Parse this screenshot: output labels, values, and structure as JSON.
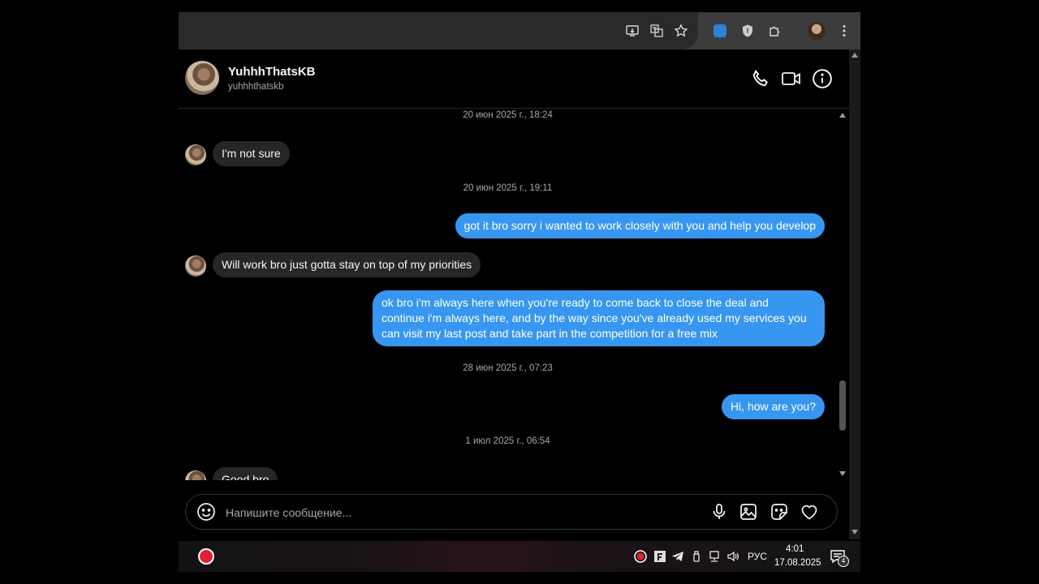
{
  "browser": {
    "icons": [
      "install-app-icon",
      "translate-icon",
      "bookmark-star-icon",
      "extension-translate-icon",
      "extension-shield-icon",
      "extensions-puzzle-icon",
      "profile-avatar",
      "menu-kebab-icon"
    ]
  },
  "chat": {
    "name": "YuhhhThatsKB",
    "username": "yuhhhthatskb",
    "header_icons": [
      "phone-icon",
      "video-icon",
      "info-icon"
    ]
  },
  "messages": [
    {
      "type": "timestamp",
      "text": "20 июн 2025 г., 18:24"
    },
    {
      "type": "incoming",
      "text": "I'm not sure"
    },
    {
      "type": "timestamp",
      "text": "20 июн 2025 г., 19:11"
    },
    {
      "type": "outgoing",
      "text": "got it bro sorry i wanted to work closely with you and help you develop"
    },
    {
      "type": "incoming",
      "text": "Will work bro just gotta stay on top of my priorities"
    },
    {
      "type": "outgoing",
      "lines": [
        "ok bro i'm always here when you're ready to come back to close the deal and",
        "continue i'm always here, and by the way since you've already used my services you",
        "can visit my last post and take part in the competition for a free mix"
      ]
    },
    {
      "type": "timestamp",
      "text": "28 июн 2025 г., 07:23"
    },
    {
      "type": "outgoing",
      "text": "Hi, how are you?"
    },
    {
      "type": "timestamp",
      "text": "1 июл 2025 г., 06:54"
    },
    {
      "type": "incoming",
      "text": "Good bro"
    }
  ],
  "composer": {
    "placeholder": "Напишите сообщение...",
    "icons": [
      "emoji-icon",
      "microphone-icon",
      "image-icon",
      "sticker-icon",
      "heart-icon"
    ]
  },
  "taskbar": {
    "language": "РУС",
    "time": "4:01",
    "date": "17.08.2025",
    "notification_count": "4",
    "tray_icons": [
      "record-icon",
      "app-f-icon",
      "telegram-icon",
      "usb-icon",
      "network-icon",
      "volume-icon"
    ]
  },
  "colors": {
    "outgoing_bubble": "#3797f0",
    "incoming_bubble": "#262626",
    "background": "#000000"
  }
}
